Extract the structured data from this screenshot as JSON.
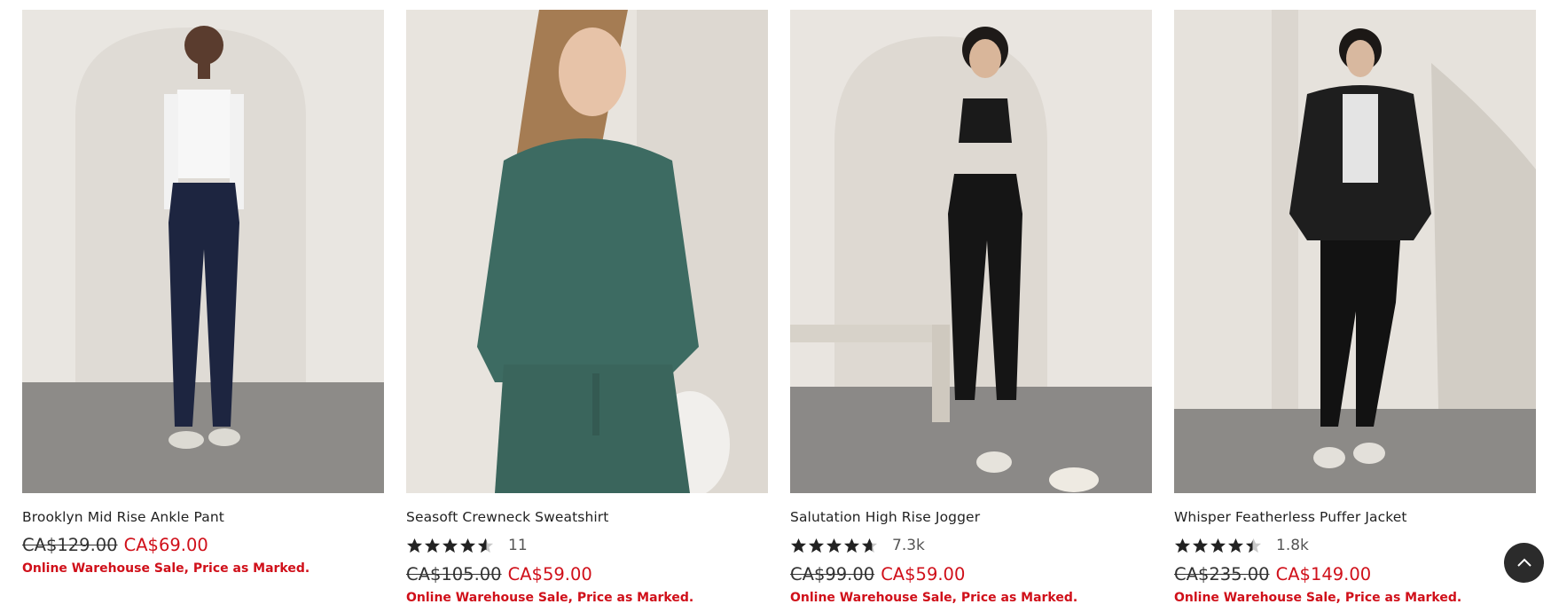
{
  "products": [
    {
      "name": "Brooklyn Mid Rise Ankle Pant",
      "rating": null,
      "review_count": null,
      "original_price": "CA$129.00",
      "sale_price": "CA$69.00",
      "promo": "Online Warehouse Sale, Price as Marked.",
      "image_alt": "model-in-white-top-navy-ankle-pant"
    },
    {
      "name": "Seasoft Crewneck Sweatshirt",
      "rating": 4.5,
      "review_count": "11",
      "original_price": "CA$105.00",
      "sale_price": "CA$59.00",
      "promo": "Online Warehouse Sale, Price as Marked.",
      "image_alt": "model-in-green-crewneck-sweatshirt"
    },
    {
      "name": "Salutation High Rise Jogger",
      "rating": 4.6,
      "review_count": "7.3k",
      "original_price": "CA$99.00",
      "sale_price": "CA$59.00",
      "promo": "Online Warehouse Sale, Price as Marked.",
      "image_alt": "model-in-black-bra-black-jogger"
    },
    {
      "name": "Whisper Featherless Puffer Jacket",
      "rating": 4.4,
      "review_count": "1.8k",
      "original_price": "CA$235.00",
      "sale_price": "CA$149.00",
      "promo": "Online Warehouse Sale, Price as Marked.",
      "image_alt": "model-in-black-quilted-puffer-jacket"
    }
  ],
  "icons": {
    "back_to_top": "chevron-up-icon",
    "star": "star-icon"
  },
  "colors": {
    "sale_red": "#d0101a",
    "back_to_top_bg": "#2b2b2b",
    "star": "#222222"
  }
}
